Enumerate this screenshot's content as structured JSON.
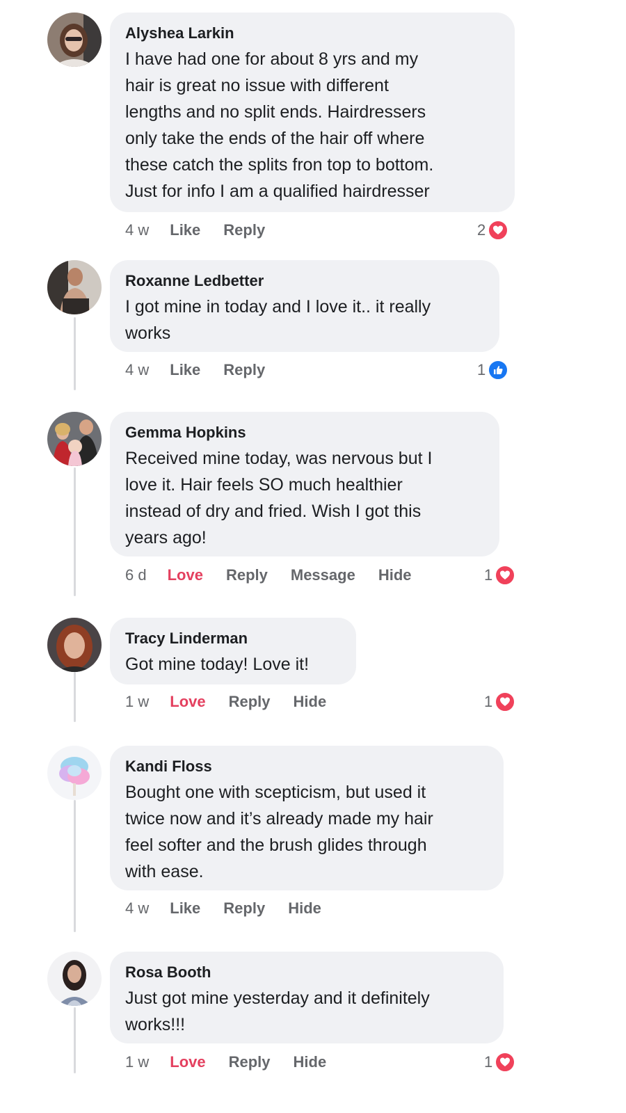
{
  "comments": [
    {
      "author": "Alyshea Larkin",
      "text": "I have had one for about 8 yrs and my\nhair is great no issue with different\nlengths and no split ends. Hairdressers\nonly take the ends of the hair off where\nthese catch the splits fron top to bottom.\nJust for info I am a qualified hairdresser",
      "time": "4 w",
      "actions": [
        "Like",
        "Reply"
      ],
      "reaction": {
        "count": "2",
        "type": "love"
      }
    },
    {
      "author": "Roxanne Ledbetter",
      "text": "I got mine in today and I love it.. it really\nworks",
      "time": "4 w",
      "actions": [
        "Like",
        "Reply"
      ],
      "reaction": {
        "count": "1",
        "type": "like"
      }
    },
    {
      "author": "Gemma Hopkins",
      "text": "Received mine today, was nervous but I\nlove it. Hair feels SO much healthier\ninstead of dry and fried. Wish I got this\nyears ago!",
      "time": "6 d",
      "actions": [
        "Love",
        "Reply",
        "Message",
        "Hide"
      ],
      "reaction": {
        "count": "1",
        "type": "love"
      }
    },
    {
      "author": "Tracy Linderman",
      "text": "Got mine today! Love it!",
      "time": "1 w",
      "actions": [
        "Love",
        "Reply",
        "Hide"
      ],
      "reaction": {
        "count": "1",
        "type": "love"
      }
    },
    {
      "author": "Kandi Floss",
      "text": "Bought one with scepticism, but used it\ntwice now and it’s already made my hair\nfeel softer and the brush glides through\nwith ease.",
      "time": "4 w",
      "actions": [
        "Like",
        "Reply",
        "Hide"
      ],
      "reaction": null
    },
    {
      "author": "Rosa Booth",
      "text": "Just got mine yesterday and it definitely\nworks!!!",
      "time": "1 w",
      "actions": [
        "Love",
        "Reply",
        "Hide"
      ],
      "reaction": {
        "count": "1",
        "type": "love"
      }
    }
  ],
  "colors": {
    "bubble": "#f0f1f4",
    "love": "#f0415a",
    "like": "#1877f2",
    "action_text": "#65676b",
    "love_text": "#e4405f"
  },
  "icons": {
    "love": "heart-icon",
    "like": "thumbs-up-icon"
  }
}
